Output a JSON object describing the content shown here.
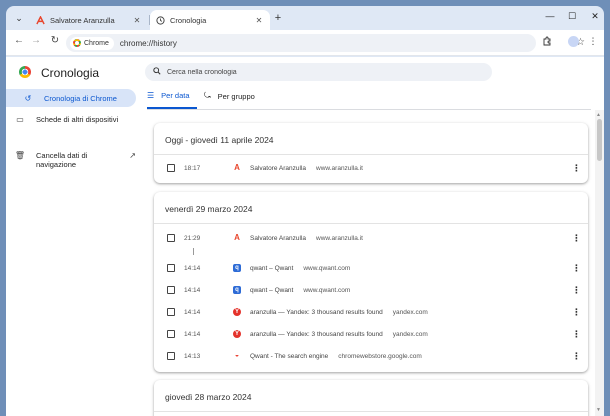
{
  "tabs": [
    {
      "title": "Salvatore Aranzulla",
      "close": "✕"
    },
    {
      "title": "Cronologia",
      "close": "✕"
    }
  ],
  "new_tab": "+",
  "window_controls": {
    "minimize": "—",
    "maximize": "☐",
    "close": "✕"
  },
  "toolbar": {
    "chip_label": "Chrome",
    "url": "chrome://history"
  },
  "app": {
    "title": "Cronologia",
    "search_placeholder": "Cerca nella cronologia"
  },
  "sidebar": {
    "items": [
      {
        "label": "Cronologia di Chrome"
      },
      {
        "label": "Schede di altri dispositivi"
      },
      {
        "label": "Cancella dati di navigazione"
      }
    ]
  },
  "page_tabs": [
    {
      "label": "Per data"
    },
    {
      "label": "Per gruppo"
    }
  ],
  "groups": [
    {
      "title": "Oggi - giovedì 11 aprile 2024",
      "rows": [
        {
          "time": "18:17",
          "title": "Salvatore Aranzulla",
          "domain": "www.aranzulla.it",
          "favicon": "aranzulla"
        }
      ]
    },
    {
      "title": "venerdì 29 marzo 2024",
      "rows": [
        {
          "time": "21:29",
          "title": "Salvatore Aranzulla",
          "domain": "www.aranzulla.it",
          "favicon": "aranzulla"
        },
        {
          "time": "14:14",
          "title": "qwant – Qwant",
          "domain": "www.qwant.com",
          "favicon": "qwant"
        },
        {
          "time": "14:14",
          "title": "qwant – Qwant",
          "domain": "www.qwant.com",
          "favicon": "qwant"
        },
        {
          "time": "14:14",
          "title": "aranzulla — Yandex: 3 thousand results found",
          "domain": "yandex.com",
          "favicon": "yandex"
        },
        {
          "time": "14:14",
          "title": "aranzulla — Yandex: 3 thousand results found",
          "domain": "yandex.com",
          "favicon": "yandex"
        },
        {
          "time": "14:13",
          "title": "Qwant - The search engine",
          "domain": "chromewebstore.google.com",
          "favicon": "chrome-web-store"
        }
      ]
    },
    {
      "title": "giovedì 28 marzo 2024",
      "rows": []
    }
  ],
  "colors": {
    "accent": "#0b57d0",
    "active_bg": "#d8e4f8",
    "frame": "#dfe8f5"
  }
}
